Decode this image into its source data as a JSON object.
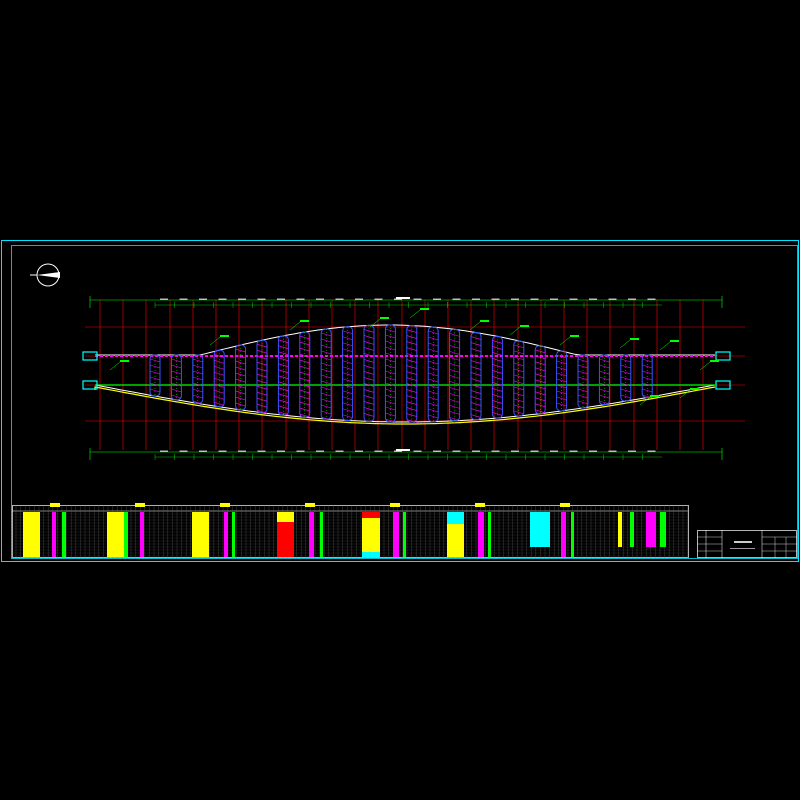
{
  "drawing": {
    "background": "#000000",
    "frame_color": "#00e5ff",
    "colors": {
      "red": "#ff0000",
      "green": "#00ff00",
      "cyan": "#00ffff",
      "blue": "#3355ff",
      "magenta": "#ff00ff",
      "yellow": "#ffff00",
      "white": "#ffffff"
    },
    "icons": [
      "north-arrow-icon"
    ],
    "title_block": {
      "drawing_title": "",
      "drawing_number": ""
    }
  }
}
